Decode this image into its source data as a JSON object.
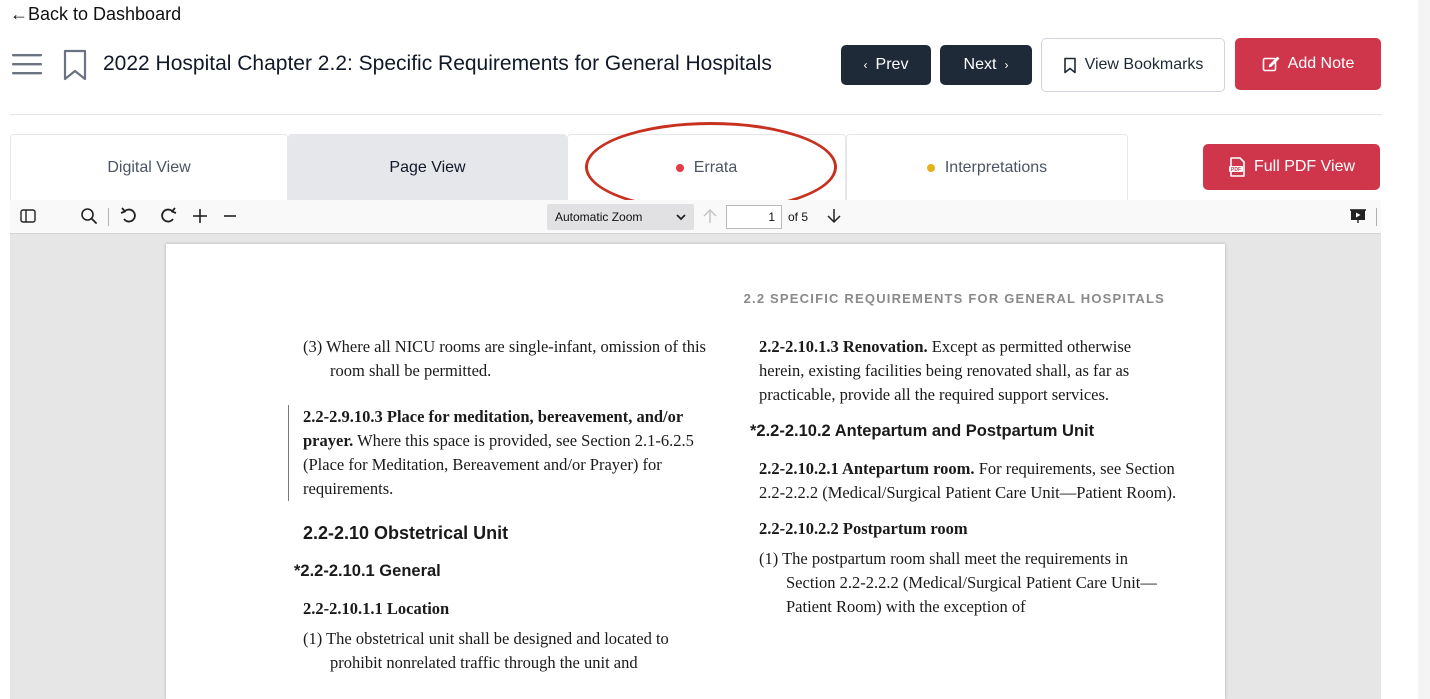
{
  "nav": {
    "back_label": "←Back to Dashboard"
  },
  "header": {
    "title": "2022 Hospital Chapter 2.2: Specific Requirements for General Hospitals",
    "prev_label": "Prev",
    "next_label": "Next",
    "bookmarks_label": "View Bookmarks",
    "add_note_label": "Add Note"
  },
  "tabs": [
    {
      "label": "Digital View",
      "active": false
    },
    {
      "label": "Page View",
      "active": true
    },
    {
      "label": "Errata",
      "dot_color": "#e53945"
    },
    {
      "label": "Interpretations",
      "dot_color": "#e3b21c"
    }
  ],
  "full_pdf_label": "Full PDF View",
  "viewer": {
    "zoom_value": "Automatic Zoom",
    "current_page": "1",
    "page_total_text": "of 5"
  },
  "document": {
    "running_head": "2.2 SPECIFIC REQUIREMENTS FOR GENERAL HOSPITALS",
    "left": {
      "p1": "(3) Where all NICU rooms are single-infant, omission of this room shall be permitted.",
      "p2_bold": "2.2-2.9.10.3 Place for meditation, bereavement, and/or prayer.",
      "p2_text": " Where this space is provided, see Section 2.1-6.2.5 (Place for Meditation, Bereavement and/or Prayer) for requirements.",
      "h1": "2.2-2.10 Obstetrical Unit",
      "h2": "*2.2-2.10.1 General",
      "h3": "2.2-2.10.1.1 Location",
      "p3": "(1) The obstetrical unit shall be designed and located to prohibit nonrelated traffic through the unit and"
    },
    "right": {
      "p1_bold": "2.2-2.10.1.3 Renovation.",
      "p1_text": " Except as permitted otherwise herein, existing facilities being renovated shall, as far as practicable, provide all the required support services.",
      "h1": "*2.2-2.10.2 Antepartum and Postpartum Unit",
      "p2_bold": "2.2-2.10.2.1 Antepartum room.",
      "p2_text": " For requirements, see Section 2.2-2.2.2 (Medical/Surgical Patient Care Unit—Patient Room).",
      "h2": "2.2-2.10.2.2 Postpartum room",
      "p3": "(1) The postpartum room shall meet the requirements in Section 2.2-2.2.2 (Medical/Surgical Patient Care Unit—Patient Room) with the exception of"
    }
  },
  "colors": {
    "primary_dark": "#1e2a38",
    "accent_red": "#d0364b",
    "annotation_circle": "#c8301f"
  }
}
